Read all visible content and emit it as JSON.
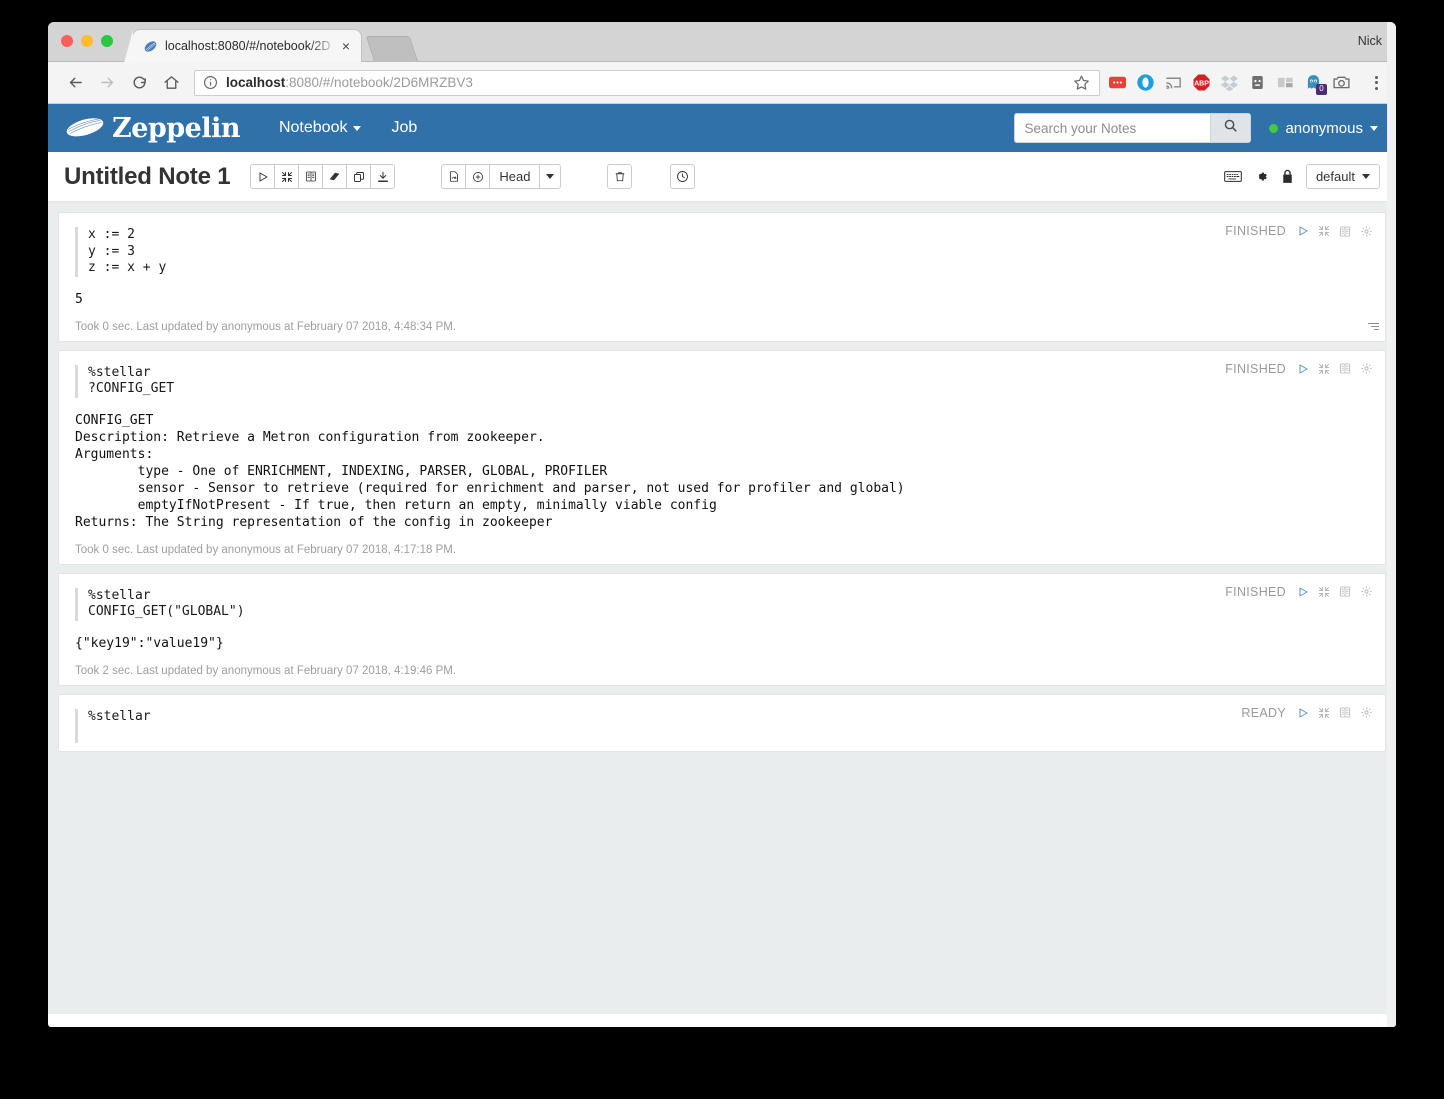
{
  "window": {
    "user_label": "Nick",
    "tab_title": "localhost:8080/#/notebook/2D",
    "tab_close": "×"
  },
  "address_bar": {
    "url_bold": "localhost",
    "url_rest": ":8080/#/notebook/2D6MRZBV3",
    "extensions": [
      "notes-extension-icon",
      "opera-circle-icon",
      "cast-icon",
      "adblock-plus-icon",
      "dropbox-icon",
      "pocket-icon",
      "tiles-icon",
      "ghostery-icon",
      "camera-icon"
    ],
    "ghostery_badge": "0"
  },
  "zeppelin_nav": {
    "brand": "Zeppelin",
    "links": [
      {
        "label": "Notebook",
        "has_caret": true
      },
      {
        "label": "Job",
        "has_caret": false
      }
    ],
    "search_placeholder": "Search your Notes",
    "search_value": "",
    "user": "anonymous",
    "brand_color": "#3071a9",
    "status_color": "#44c944"
  },
  "note_header": {
    "title": "Untitled Note 1",
    "run_group": [
      "run-all-icon",
      "hide-all-icon",
      "show-all-output-icon",
      "clear-output-icon",
      "clone-note-icon",
      "export-note-icon"
    ],
    "version_group": [
      "commit-icon",
      "add-revision-icon"
    ],
    "version_label": "Head",
    "trash_icon": "trash-icon",
    "schedule_icon": "scheduler-icon",
    "right_icons": [
      "keyboard-shortcuts-icon",
      "note-settings-icon",
      "permissions-lock-icon"
    ],
    "interpreter_binding": "default"
  },
  "paragraphs": [
    {
      "id": "paragraph-1",
      "status": "FINISHED",
      "code": [
        "x := 2",
        "y := 3",
        "z := x + y"
      ],
      "output": [
        "5"
      ],
      "footer": "Took 0 sec. Last updated by anonymous at February 07 2018, 4:48:34 PM.",
      "has_resize_grip": true
    },
    {
      "id": "paragraph-2",
      "status": "FINISHED",
      "code": [
        "%stellar",
        "?CONFIG_GET"
      ],
      "output": [
        "CONFIG_GET",
        "Description: Retrieve a Metron configuration from zookeeper.",
        "Arguments:",
        "        type - One of ENRICHMENT, INDEXING, PARSER, GLOBAL, PROFILER",
        "        sensor - Sensor to retrieve (required for enrichment and parser, not used for profiler and global)",
        "        emptyIfNotPresent - If true, then return an empty, minimally viable config",
        "Returns: The String representation of the config in zookeeper"
      ],
      "footer": "Took 0 sec. Last updated by anonymous at February 07 2018, 4:17:18 PM.",
      "has_resize_grip": false
    },
    {
      "id": "paragraph-3",
      "status": "FINISHED",
      "code": [
        "%stellar",
        "CONFIG_GET(\"GLOBAL\")"
      ],
      "output": [
        "{\"key19\":\"value19\"}"
      ],
      "footer": "Took 2 sec. Last updated by anonymous at February 07 2018, 4:19:46 PM.",
      "has_resize_grip": false
    },
    {
      "id": "paragraph-4",
      "status": "READY",
      "code": [
        "%stellar"
      ],
      "output": [],
      "footer": "",
      "has_resize_grip": false
    }
  ],
  "paragraph_icons": [
    "run-paragraph-icon",
    "hide-editor-icon",
    "show-output-icon",
    "settings-gear-icon"
  ]
}
